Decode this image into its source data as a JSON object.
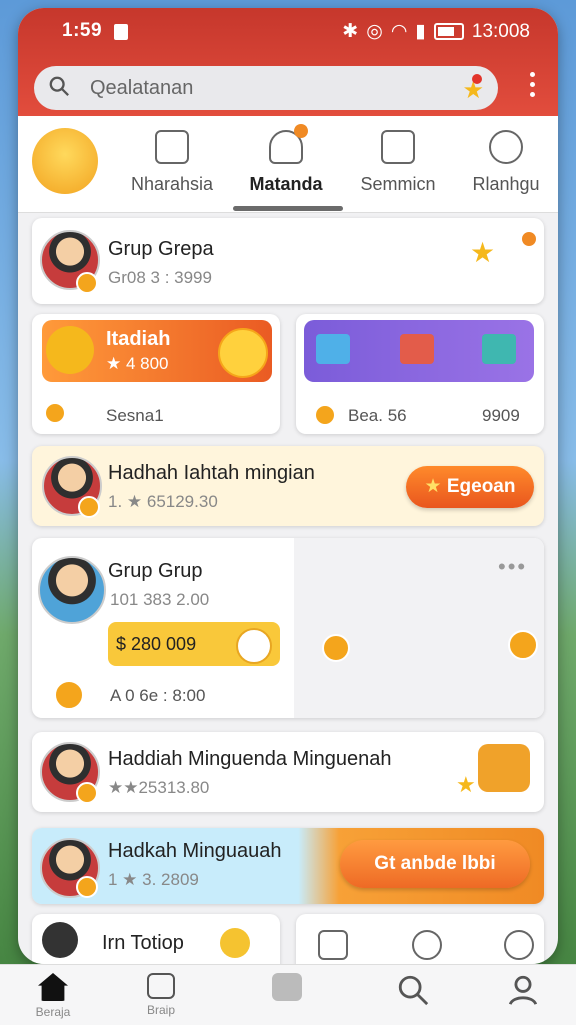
{
  "status": {
    "time": "1:59",
    "clock_right": "13:008"
  },
  "search": {
    "placeholder": "Qealatanan"
  },
  "tabs": [
    {
      "label": "Nharahsia"
    },
    {
      "label": "Matanda"
    },
    {
      "label": "Semmicn"
    },
    {
      "label": "Rlanhgu"
    }
  ],
  "cards": {
    "group1": {
      "title": "Grup Grepa",
      "subtitle": "Gr08 3 : 3999"
    },
    "promo_left": {
      "title": "Itadiah",
      "value": "★ 4 800",
      "footer": "Sesna1"
    },
    "promo_right": {
      "footer_left": "Bea. 56",
      "footer_right": "9909"
    },
    "weekly": {
      "title": "Hadhah Iahtah mingian",
      "subtitle": "1. ★ 65129.30",
      "button": "Egeoan"
    },
    "group2": {
      "title": "Grup Grup",
      "subtitle": "101 383 2.00",
      "amount": "$ 280 009",
      "footer": "A 0 6e : 8:00"
    },
    "reward1": {
      "title": "Haddiah Minguenda Minguenah",
      "subtitle": "★★25313.80"
    },
    "reward2": {
      "title": "Hadkah Minguauah",
      "subtitle": "1 ★ 3. 2809",
      "button": "Gt anbde lbbi"
    },
    "bottom_partial": {
      "title": "Irn Totiop"
    }
  },
  "nav": [
    {
      "label": "Beraja",
      "icon": "home-icon"
    },
    {
      "label": "Braip",
      "icon": "list-icon"
    },
    {
      "label": "",
      "icon": "square-icon"
    },
    {
      "label": "",
      "icon": "search-icon"
    },
    {
      "label": "",
      "icon": "profile-icon"
    }
  ],
  "colors": {
    "accent": "#e24d3d",
    "orange": "#f08a24",
    "gold": "#f5b81c",
    "purple": "#7a5bd8"
  }
}
